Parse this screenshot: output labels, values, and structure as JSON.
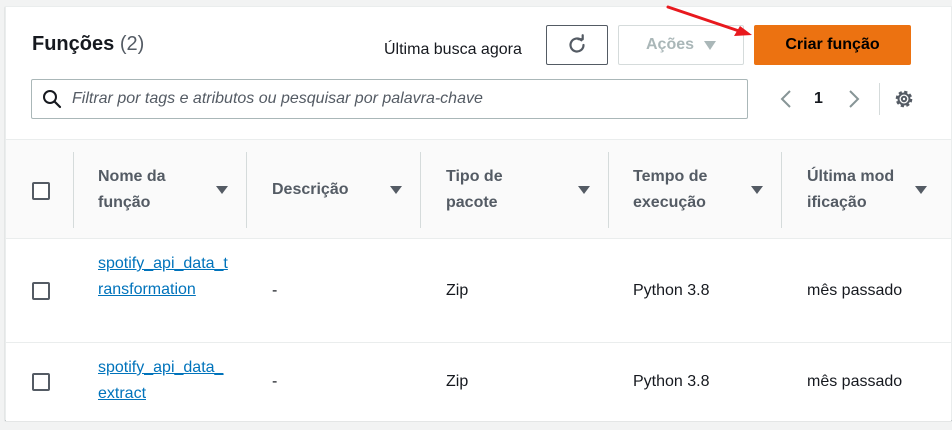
{
  "header": {
    "title": "Funções",
    "count": "(2)",
    "last_fetch": "Última busca agora",
    "actions_label": "Ações",
    "create_label": "Criar função"
  },
  "search": {
    "placeholder": "Filtrar por tags e atributos ou pesquisar por palavra-chave"
  },
  "pagination": {
    "current_page": "1"
  },
  "table": {
    "columns": [
      "Nome da função",
      "Descrição",
      "Tipo de pacote",
      "Tempo de execução",
      "Última modificação"
    ],
    "rows": [
      {
        "name": "spotify_api_data_transformation",
        "description": "-",
        "package": "Zip",
        "runtime": "Python 3.8",
        "modified": "mês passado"
      },
      {
        "name": "spotify_api_data_extract",
        "description": "-",
        "package": "Zip",
        "runtime": "Python 3.8",
        "modified": "mês passado"
      }
    ]
  },
  "colors": {
    "primary_button": "#ec7211",
    "link": "#0073bb",
    "annotation_arrow": "#e8191e"
  },
  "icons": [
    "refresh-icon",
    "caret-down-icon",
    "search-icon",
    "chevron-left-icon",
    "chevron-right-icon",
    "gear-icon",
    "sort-caret-icon"
  ]
}
